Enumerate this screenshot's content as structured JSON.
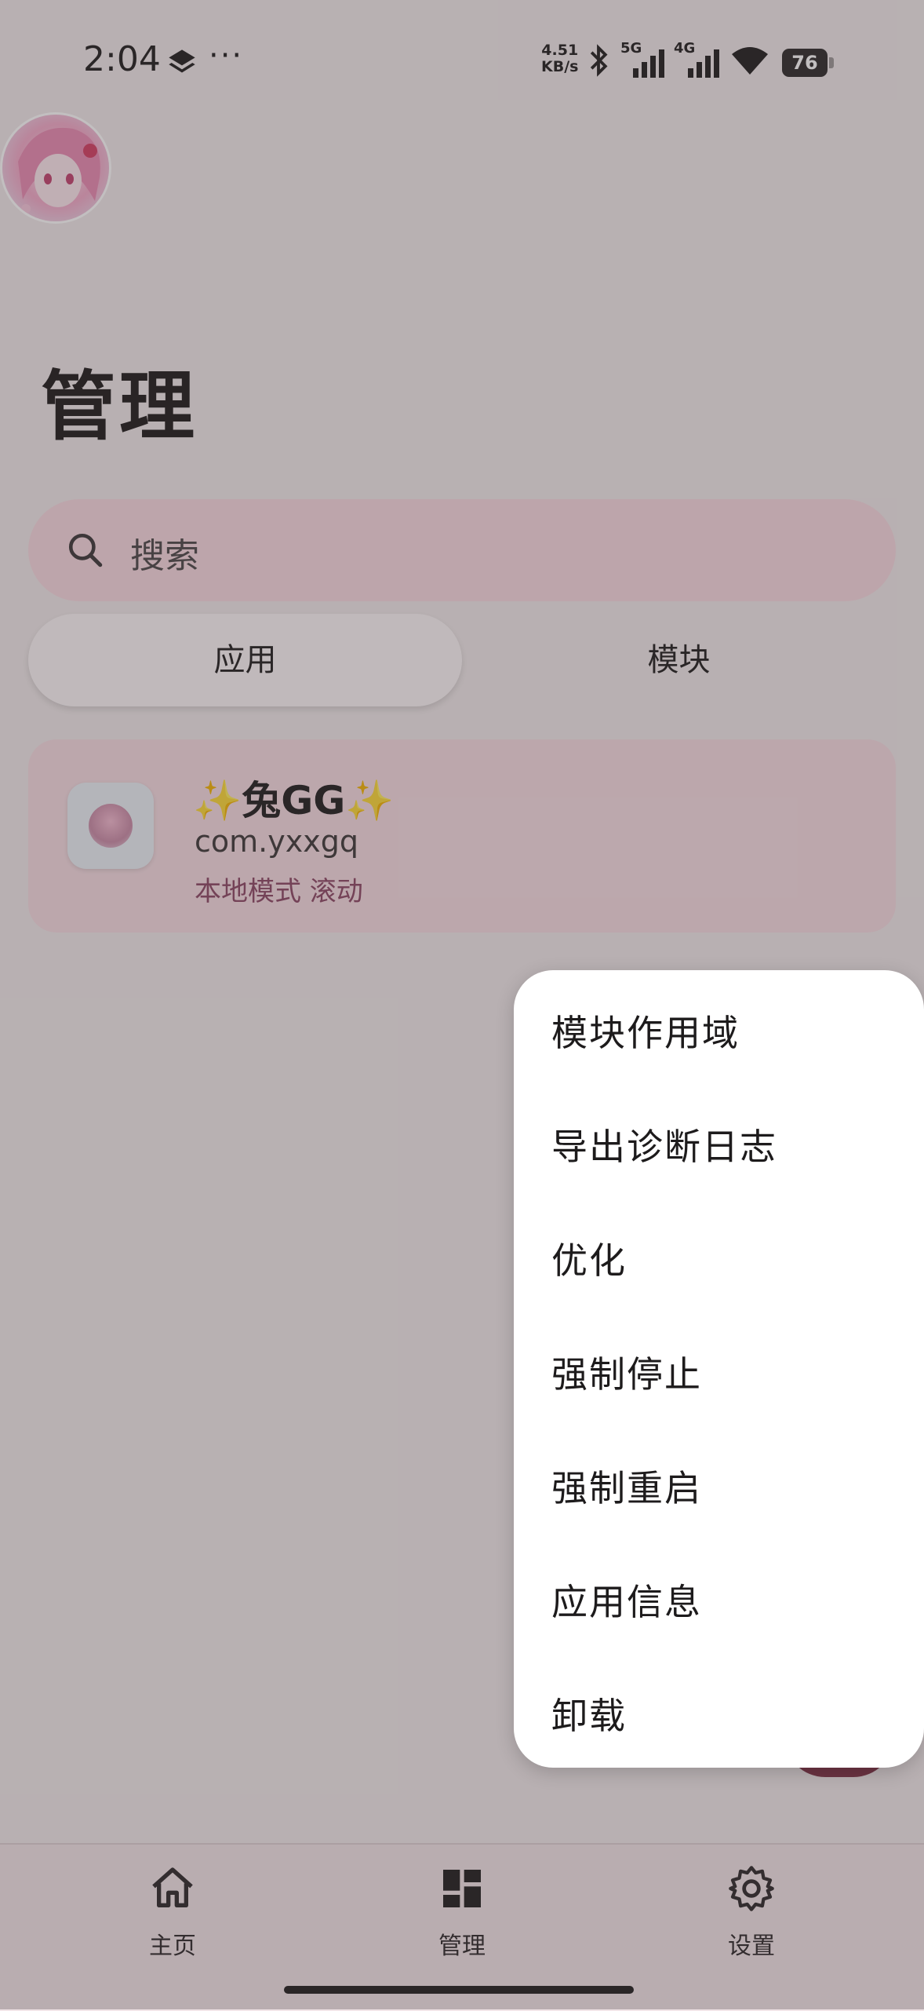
{
  "status_bar": {
    "time": "2:04",
    "speed_value": "4.51",
    "speed_unit": "KB/s",
    "net1": "5G",
    "net2": "4G",
    "battery": "76",
    "icons": [
      "layers-icon",
      "more-dots-icon",
      "bluetooth-icon",
      "signal-icon",
      "wifi-icon",
      "battery-icon"
    ]
  },
  "header": {
    "title": "管理"
  },
  "search": {
    "placeholder": "搜索"
  },
  "tabs": [
    {
      "label": "应用",
      "active": true
    },
    {
      "label": "模块",
      "active": false
    }
  ],
  "app_card": {
    "name": "✨兔GG✨",
    "package": "com.yxxgq",
    "tags": "本地模式 滚动"
  },
  "menu": {
    "items": [
      {
        "label": "模块作用域"
      },
      {
        "label": "导出诊断日志"
      },
      {
        "label": "优化"
      },
      {
        "label": "强制停止"
      },
      {
        "label": "强制重启"
      },
      {
        "label": "应用信息"
      },
      {
        "label": "卸载"
      }
    ]
  },
  "bottom_nav": {
    "items": [
      {
        "label": "主页",
        "icon": "home-icon"
      },
      {
        "label": "管理",
        "icon": "dashboard-icon",
        "active": true
      },
      {
        "label": "设置",
        "icon": "gear-icon"
      }
    ]
  },
  "colors": {
    "search_bg": "#f8d9e0",
    "card_bg": "#f6dce2",
    "tag_color": "#8b4563",
    "accent": "#6b3342"
  }
}
